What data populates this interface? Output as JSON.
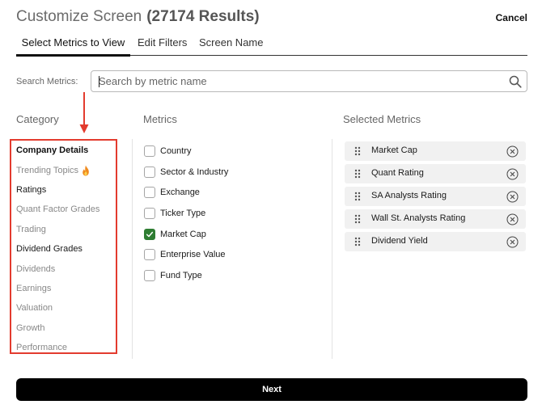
{
  "header": {
    "title": "Customize Screen",
    "results": "(27174 Results)",
    "cancel_label": "Cancel"
  },
  "tabs": [
    {
      "label": "Select Metrics to View",
      "active": true
    },
    {
      "label": "Edit Filters",
      "active": false
    },
    {
      "label": "Screen Name",
      "active": false
    }
  ],
  "search": {
    "label": "Search Metrics:",
    "placeholder": "Search by metric name",
    "value": ""
  },
  "columns": {
    "category": "Category",
    "metrics": "Metrics",
    "selected": "Selected Metrics"
  },
  "categories": [
    {
      "label": "Company Details",
      "state": "selected"
    },
    {
      "label": "Trending Topics",
      "state": "muted",
      "icon": "fire-icon"
    },
    {
      "label": "Ratings",
      "state": "dark"
    },
    {
      "label": "Quant Factor Grades",
      "state": "muted"
    },
    {
      "label": "Trading",
      "state": "muted"
    },
    {
      "label": "Dividend Grades",
      "state": "dark"
    },
    {
      "label": "Dividends",
      "state": "muted"
    },
    {
      "label": "Earnings",
      "state": "muted"
    },
    {
      "label": "Valuation",
      "state": "muted"
    },
    {
      "label": "Growth",
      "state": "muted"
    },
    {
      "label": "Performance",
      "state": "muted"
    }
  ],
  "metrics": [
    {
      "label": "Country",
      "checked": false
    },
    {
      "label": "Sector & Industry",
      "checked": false
    },
    {
      "label": "Exchange",
      "checked": false
    },
    {
      "label": "Ticker Type",
      "checked": false
    },
    {
      "label": "Market Cap",
      "checked": true
    },
    {
      "label": "Enterprise Value",
      "checked": false
    },
    {
      "label": "Fund Type",
      "checked": false
    }
  ],
  "selected_metrics": [
    {
      "label": "Market Cap"
    },
    {
      "label": "Quant Rating"
    },
    {
      "label": "SA Analysts Rating"
    },
    {
      "label": "Wall St. Analysts Rating"
    },
    {
      "label": "Dividend Yield"
    }
  ],
  "footer": {
    "next_label": "Next"
  },
  "colors": {
    "highlight": "#e33b2e",
    "checked": "#2e7d32",
    "button": "#000000"
  }
}
